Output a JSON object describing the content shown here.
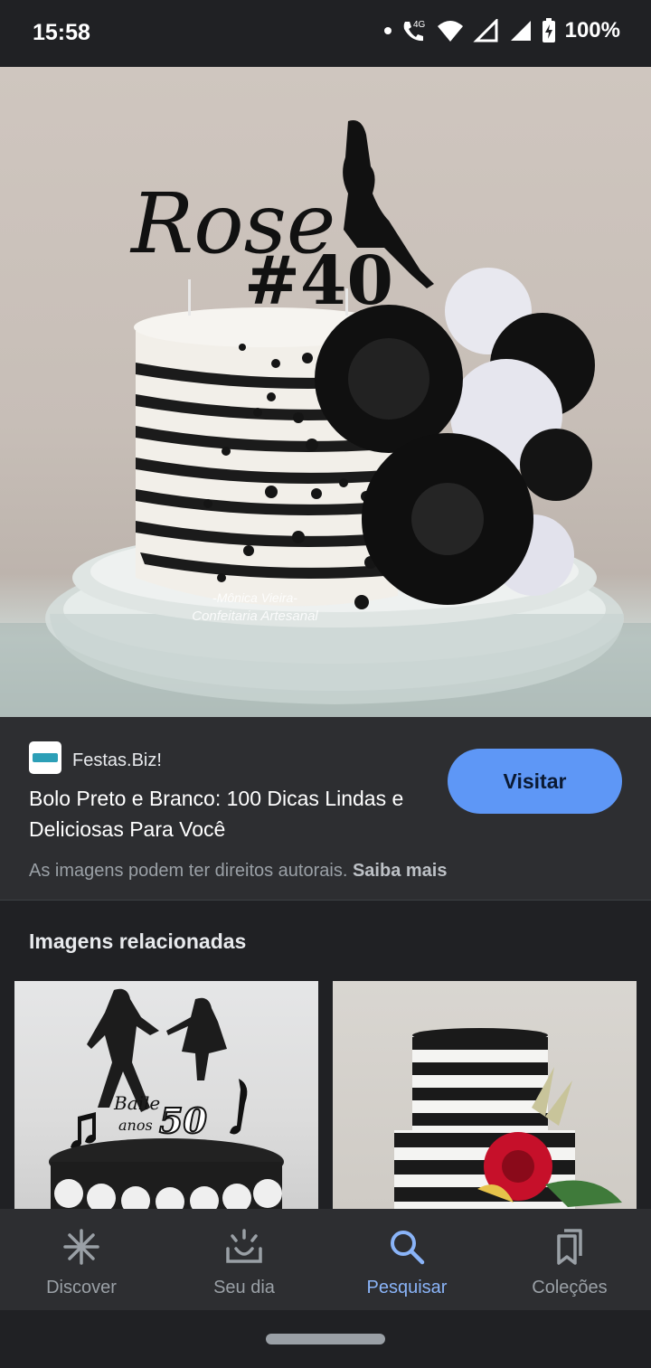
{
  "status_bar": {
    "time": "15:58",
    "network": "4G",
    "battery": "100%"
  },
  "hero_image": {
    "topper_name": "Rose",
    "topper_number": "#40",
    "watermark_line1": "-Mônica Vieira-",
    "watermark_line2": "Confeitaria Artesanal"
  },
  "result": {
    "site_name": "Festas.Biz!",
    "title": "Bolo Preto e Branco: 100 Dicas Lindas e Deliciosas Para Você",
    "visit_label": "Visitar",
    "copyright_text": "As imagens podem ter direitos autorais.",
    "learn_more": "Saiba mais"
  },
  "related": {
    "heading": "Imagens relacionadas",
    "thumb1_text_line1": "Baile",
    "thumb1_text_line2": "anos",
    "thumb1_number": "50"
  },
  "bottom_nav": {
    "items": [
      {
        "label": "Discover",
        "icon": "asterisk-icon"
      },
      {
        "label": "Seu dia",
        "icon": "sunrise-icon"
      },
      {
        "label": "Pesquisar",
        "icon": "search-icon"
      },
      {
        "label": "Coleções",
        "icon": "collections-icon"
      }
    ],
    "active_index": 2
  },
  "colors": {
    "accent": "#8ab4f8",
    "visit_button": "#5e97f6",
    "background": "#202124",
    "panel": "#2d2e31"
  }
}
